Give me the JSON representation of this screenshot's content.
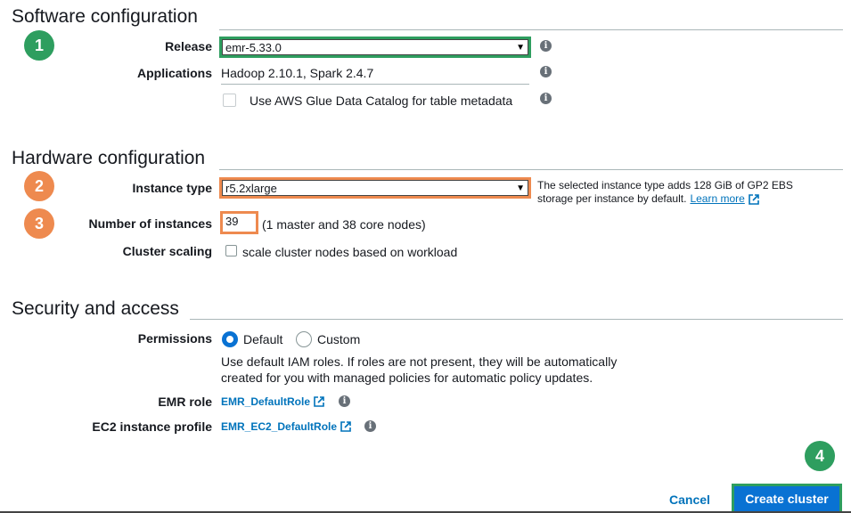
{
  "software": {
    "title": "Software configuration",
    "badge": "1",
    "release_label": "Release",
    "release_value": "emr-5.33.0",
    "applications_label": "Applications",
    "applications_value": "Hadoop 2.10.1, Spark 2.4.7",
    "glue_label": "Use AWS Glue Data Catalog for table metadata"
  },
  "hardware": {
    "title": "Hardware configuration",
    "badge_instance": "2",
    "badge_count": "3",
    "instance_type_label": "Instance type",
    "instance_type_value": "r5.2xlarge",
    "instance_note_line1": "The selected instance type adds 128 GiB of GP2 EBS",
    "instance_note_line2": "storage per instance by default.",
    "learn_more": "Learn more",
    "num_instances_label": "Number of instances",
    "num_instances_value": "39",
    "num_instances_note": "(1 master and 38 core nodes)",
    "scaling_label": "Cluster scaling",
    "scaling_checkbox_label": "scale cluster nodes based on workload"
  },
  "security": {
    "title": "Security and access",
    "permissions_label": "Permissions",
    "option_default": "Default",
    "option_custom": "Custom",
    "default_desc_line1": "Use default IAM roles. If roles are not present, they will be automatically",
    "default_desc_line2": "created for you with managed policies for automatic policy updates.",
    "emr_role_label": "EMR role",
    "emr_role_value": "EMR_DefaultRole",
    "ec2_profile_label": "EC2 instance profile",
    "ec2_profile_value": "EMR_EC2_DefaultRole"
  },
  "actions": {
    "badge": "4",
    "cancel": "Cancel",
    "create": "Create cluster"
  },
  "colors": {
    "highlight_green": "#2e9e5f",
    "highlight_orange": "#ee8a4f",
    "primary_blue": "#0972d3",
    "link_blue": "#0073bb"
  }
}
